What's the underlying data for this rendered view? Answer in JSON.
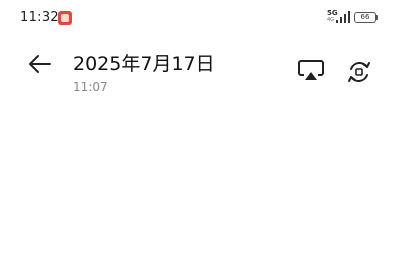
{
  "status_bar": {
    "time": "11:32",
    "network_primary": "5G",
    "network_secondary": "4G",
    "battery": "66",
    "icons": [
      "app-notification-icon",
      "signal-icon",
      "battery-icon"
    ]
  },
  "header": {
    "title": "2025年7月17日",
    "subtitle": "11:07",
    "icons": [
      "back-arrow-icon",
      "cast-icon",
      "rotate-icon"
    ]
  }
}
